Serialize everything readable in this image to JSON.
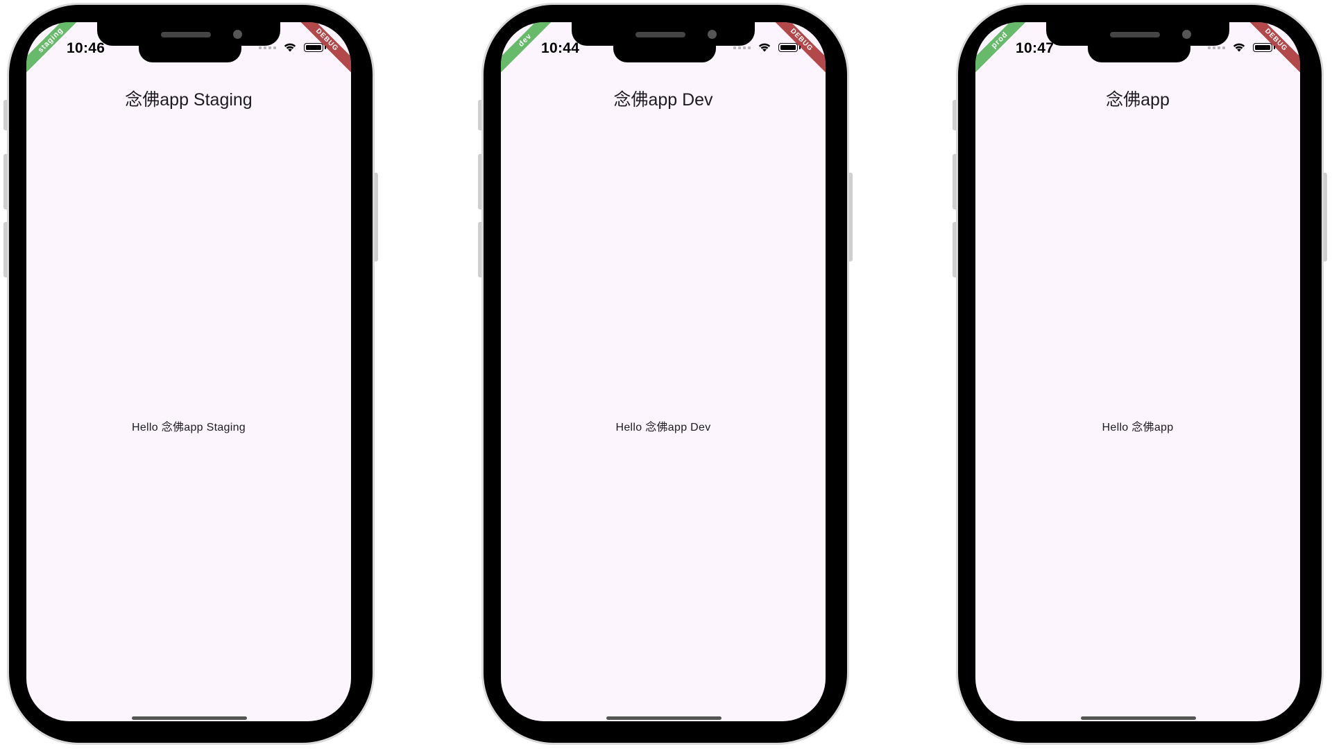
{
  "phones": [
    {
      "env_banner": "staging",
      "debug_banner": "DEBUG",
      "time": "10:46",
      "app_title": "念佛app Staging",
      "body_text": "Hello 念佛app Staging"
    },
    {
      "env_banner": "dev",
      "debug_banner": "DEBUG",
      "time": "10:44",
      "app_title": "念佛app Dev",
      "body_text": "Hello 念佛app Dev"
    },
    {
      "env_banner": "prod",
      "debug_banner": "DEBUG",
      "time": "10:47",
      "app_title": "念佛app",
      "body_text": "Hello 念佛app"
    }
  ],
  "colors": {
    "screen_background": "#fcf5fd",
    "env_banner": "#4caf50",
    "debug_banner": "#a52a2a",
    "bezel": "#000000"
  },
  "icons": {
    "signal": "cellular-signal-icon",
    "wifi": "wifi-icon",
    "battery": "battery-icon"
  }
}
